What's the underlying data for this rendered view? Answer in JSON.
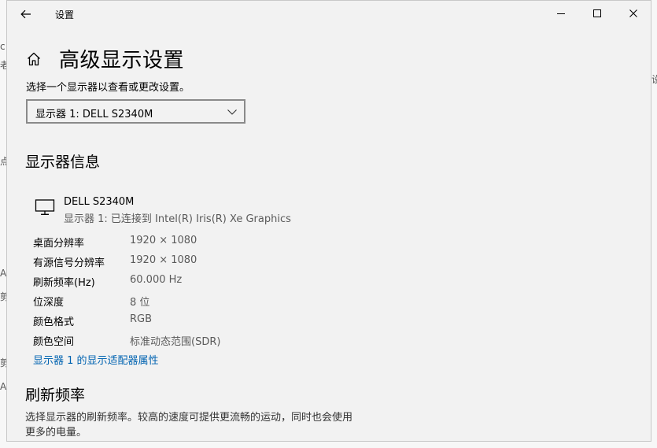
{
  "window": {
    "title": "设置",
    "back_icon": "arrow-left-icon",
    "minimize_icon": "minimize-icon",
    "maximize_icon": "maximize-icon",
    "close_icon": "close-icon"
  },
  "header": {
    "home_icon": "home-icon",
    "title": "高级显示设置",
    "subtitle": "选择一个显示器以查看或更改设置。"
  },
  "display_selector": {
    "selected": "显示器 1: DELL S2340M",
    "chevron_icon": "chevron-down-icon"
  },
  "display_info": {
    "section_title": "显示器信息",
    "monitor_icon": "monitor-icon",
    "monitor_name": "DELL S2340M",
    "monitor_connection": "显示器 1: 已连接到 Intel(R) Iris(R) Xe Graphics",
    "rows": [
      {
        "label": "桌面分辨率",
        "value": "1920 × 1080"
      },
      {
        "label": "有源信号分辨率",
        "value": "1920 × 1080"
      },
      {
        "label": "刷新频率(Hz)",
        "value": "60.000 Hz"
      },
      {
        "label": "位深度",
        "value": "8 位"
      },
      {
        "label": "颜色格式",
        "value": "RGB"
      },
      {
        "label": "颜色空间",
        "value": "标准动态范围(SDR)"
      }
    ],
    "adapter_link": "显示器 1 的显示适配器属性"
  },
  "refresh_rate": {
    "section_title": "刷新频率",
    "description_line1": "选择显示器的刷新频率。较高的速度可提供更流畅的运动，同时也会使用",
    "description_line2": "更多的电量。"
  },
  "colors": {
    "accent_link": "#0063b1",
    "window_bg": "#f2f2f2"
  }
}
